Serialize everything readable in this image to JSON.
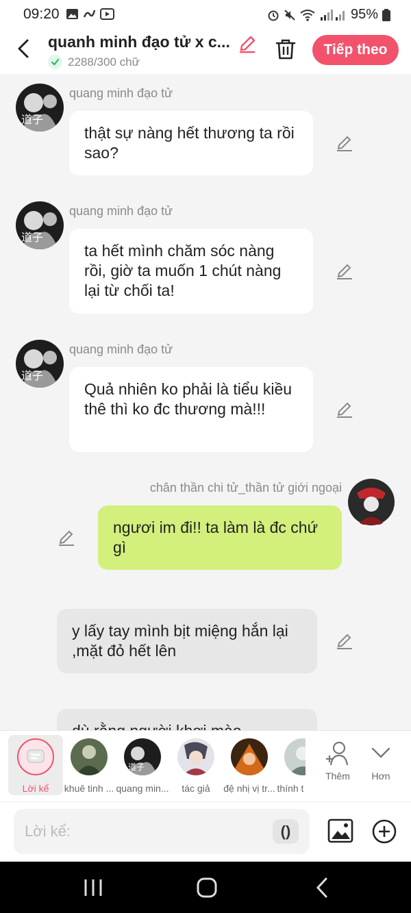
{
  "status": {
    "time": "09:20",
    "battery": "95%"
  },
  "header": {
    "title": "quanh minh đạo tử x c...",
    "word_count": "2288/300 chữ",
    "next_label": "Tiếp theo",
    "accent": "#f2526b"
  },
  "messages": [
    {
      "sender": "quang minh đạo tử",
      "text": "thật sự nàng hết thương ta rồi sao?"
    },
    {
      "sender": "quang minh đạo tử",
      "text": "ta hết mình chăm sóc nàng rồi, giờ ta muốn 1 chút nàng lại từ chối ta!"
    },
    {
      "sender": "quang minh đạo tử",
      "text": "Quả nhiên  ko phải là  tiểu kiều thê thì ko đc thương mà!!!"
    },
    {
      "sender": "chân thần chi tử_thần tử giới ngoại",
      "text": "ngươi im đi!! ta làm là đc chứ gì",
      "bubble_color": "#d3ef7c"
    },
    {
      "sender": "",
      "text": "y lấy tay mình bịt miệng hắn lại ,mặt đỏ hết lên"
    },
    {
      "sender": "",
      "text": "dù rằng người khơi mào"
    }
  ],
  "characters": [
    {
      "label": "Lời kể",
      "selected": true
    },
    {
      "label": "khuê tinh ..."
    },
    {
      "label": "quang min..."
    },
    {
      "label": "tác giả"
    },
    {
      "label": "đệ nhị vị tr..."
    },
    {
      "label": "thính t"
    }
  ],
  "tools": {
    "more_people": "Thêm",
    "collapse": "Hơn"
  },
  "input": {
    "placeholder": "Lời kể:",
    "paren": "()"
  }
}
